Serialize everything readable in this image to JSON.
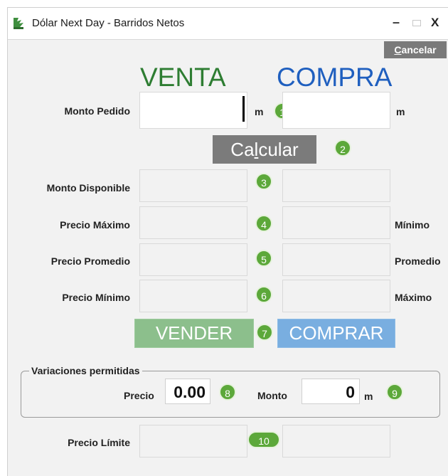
{
  "window": {
    "title": "Dólar Next Day - Barridos Netos",
    "icons": {
      "app": "app-logo-icon",
      "minimize": "minimize-icon",
      "maximize": "maximize-icon",
      "close": "close-icon"
    },
    "min_glyph": "–",
    "close_glyph": "X"
  },
  "toolbar": {
    "cancel_label_pre": "",
    "cancel_label_key": "C",
    "cancel_label_post": "ancelar"
  },
  "headers": {
    "venta": "VENTA",
    "compra": "COMPRA"
  },
  "form": {
    "monto_pedido_label": "Monto Pedido",
    "unit_m": "m",
    "calcular_pre": "Ca",
    "calcular_key": "l",
    "calcular_post": "cular",
    "rows": {
      "monto_disponible": "Monto Disponible",
      "precio_maximo": "Precio Máximo",
      "precio_promedio": "Precio Promedio",
      "precio_minimo": "Precio Mínimo",
      "right_minimo": "Mínimo",
      "right_promedio": "Promedio",
      "right_maximo": "Máximo"
    },
    "vender_label": "VENDER",
    "comprar_label": "COMPRAR"
  },
  "variaciones": {
    "title": "Variaciones permitidas",
    "precio_label": "Precio",
    "precio_value": "0.00",
    "monto_label": "Monto",
    "monto_value": "0",
    "monto_unit": "m"
  },
  "limite": {
    "label": "Precio Límite"
  },
  "badges": [
    "1",
    "2",
    "3",
    "4",
    "5",
    "6",
    "7",
    "8",
    "9",
    "10"
  ],
  "colors": {
    "venta": "#2e7d32",
    "compra": "#1f5fbf",
    "badge": "#5ca83a",
    "vender": "#8cbf8c",
    "comprar": "#79aee0"
  }
}
